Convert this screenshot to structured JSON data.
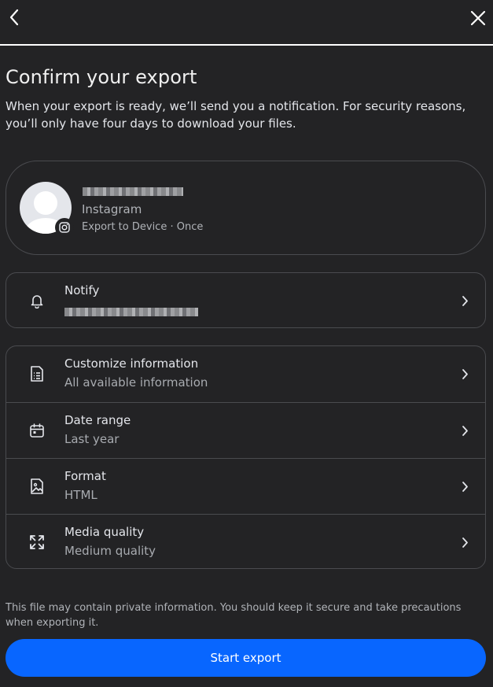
{
  "header": {
    "back_icon": "chevron-left-icon",
    "close_icon": "close-icon"
  },
  "page": {
    "title": "Confirm your export",
    "subtitle": "When your export is ready, we’ll send you a notification. For security reasons, you’ll only have four days to download your files."
  },
  "account": {
    "app": "Instagram",
    "meta": "Export to Device · Once",
    "badge_icon": "instagram-icon"
  },
  "notify": {
    "label": "Notify",
    "icon": "bell-icon"
  },
  "settings": {
    "rows": [
      {
        "label": "Customize information",
        "value": "All available information",
        "icon": "document-list-icon"
      },
      {
        "label": "Date range",
        "value": "Last year",
        "icon": "calendar-icon"
      },
      {
        "label": "Format",
        "value": "HTML",
        "icon": "image-file-icon"
      },
      {
        "label": "Media quality",
        "value": "Medium quality",
        "icon": "expand-arrows-icon"
      }
    ]
  },
  "footer": {
    "disclaimer": "This file may contain private information. You should keep it secure and take precautions when exporting it.",
    "start_label": "Start export"
  },
  "colors": {
    "background": "#232325",
    "border": "#4a4b4f",
    "primary_button": "#0866ff",
    "text_primary": "#e4e6eb",
    "text_secondary": "#b0b3b8"
  }
}
